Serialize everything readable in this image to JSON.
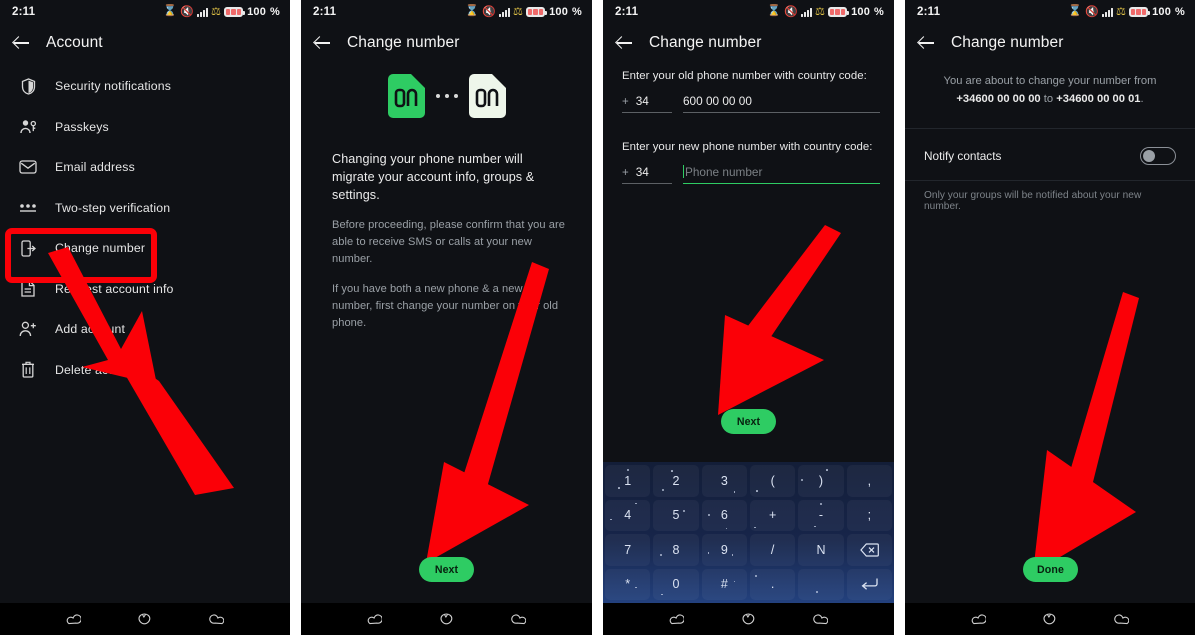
{
  "status_bar": {
    "time": "2:11",
    "battery_text": "100",
    "battery_suffix": "%",
    "icons": [
      "hourglass-icon",
      "vibrate-off-icon",
      "signal-bars-icon",
      "mobile-data-icon",
      "battery-icon"
    ]
  },
  "colors": {
    "accent_green": "#2ecc63",
    "highlight_red": "#fb0007",
    "screen_bg": "#0f1115",
    "nav_bg": "#000000",
    "keyboard_top": "#131e38",
    "keyboard_bottom": "#23417e"
  },
  "panel1": {
    "title": "Account",
    "back_icon": "back-arrow-icon",
    "items": [
      {
        "label": "Security notifications",
        "icon": "shield-icon"
      },
      {
        "label": "Passkeys",
        "icon": "passkey-icon"
      },
      {
        "label": "Email address",
        "icon": "envelope-icon"
      },
      {
        "label": "Two-step verification",
        "icon": "dots-underline-icon"
      },
      {
        "label": "Change number",
        "icon": "change-number-icon",
        "highlighted": true
      },
      {
        "label": "Request account info",
        "icon": "document-icon"
      },
      {
        "label": "Add account",
        "icon": "add-person-icon"
      },
      {
        "label": "Delete account",
        "icon": "trash-icon"
      }
    ]
  },
  "panel2": {
    "title": "Change number",
    "hero_icons": [
      "sim-card-green-icon",
      "three-dots-icon",
      "sim-card-white-icon"
    ],
    "headline": "Changing your phone number will migrate your account info, groups & settings.",
    "body1": "Before proceeding, please confirm that you are able to receive SMS or calls at your new number.",
    "body2": "If you have both a new phone & a new number, first change your number on your old phone.",
    "next_label": "Next"
  },
  "panel3": {
    "title": "Change number",
    "old_label": "Enter your old phone number with country code:",
    "old_country_plus": "+",
    "old_country_code": "34",
    "old_number": "600 00 00 00",
    "new_label": "Enter your new phone number with country code:",
    "new_country_plus": "+",
    "new_country_code": "34",
    "new_placeholder": "Phone number",
    "next_label": "Next",
    "keyboard": {
      "rows": [
        [
          "1",
          "2",
          "3",
          "(",
          ")",
          ","
        ],
        [
          "4",
          "5",
          "6",
          "+",
          "-",
          ";"
        ],
        [
          "7",
          "8",
          "9",
          "/",
          "N",
          "backspace-icon"
        ],
        [
          "*",
          "0",
          "#",
          ".",
          "",
          "enter-icon"
        ]
      ]
    }
  },
  "panel4": {
    "title": "Change number",
    "confirm_prefix": "You are about to change your number from ",
    "confirm_old": "+34600 00 00 00",
    "confirm_mid": " to ",
    "confirm_new": "+34600 00 00 01",
    "confirm_suffix": ".",
    "notify_label": "Notify contacts",
    "notify_state": "off",
    "footnote": "Only your groups will be notified about your new number.",
    "done_label": "Done"
  },
  "navbar": {
    "items": [
      {
        "name": "nav-back",
        "icon": "nav-back-icon"
      },
      {
        "name": "nav-home",
        "icon": "nav-home-icon"
      },
      {
        "name": "nav-recents",
        "icon": "nav-recents-icon"
      }
    ]
  }
}
